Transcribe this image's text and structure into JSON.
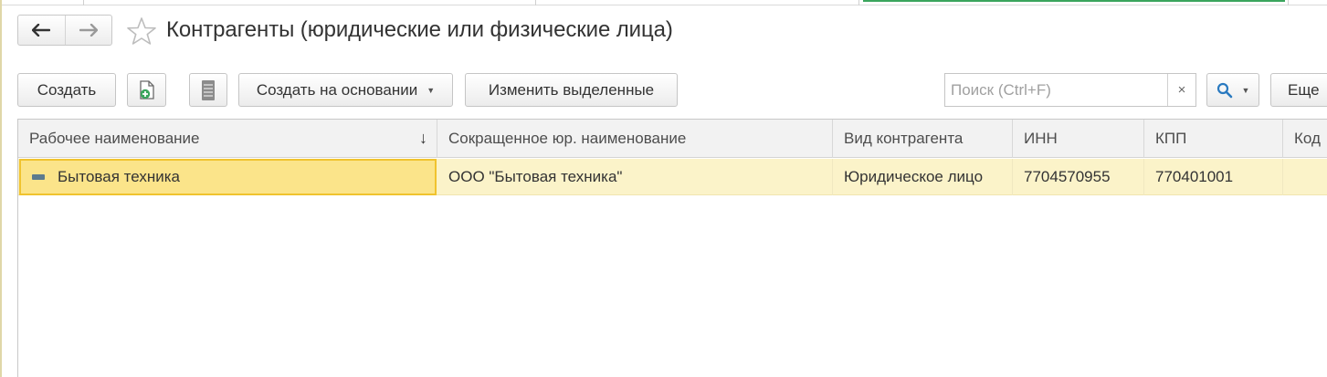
{
  "colors": {
    "accent_green": "#3aa55d",
    "selected_row": "#fbf3c9",
    "active_cell": "#fbe48a",
    "active_cell_border": "#f0c32e",
    "search_icon": "#2a7ac0"
  },
  "nav": {
    "back_icon": "arrow-left-icon",
    "forward_icon": "arrow-right-icon",
    "favorite_icon": "star-icon"
  },
  "window": {
    "title": "Контрагенты (юридические или физические лица)"
  },
  "toolbar": {
    "create_label": "Создать",
    "create_copy_icon": "add-document-icon",
    "list_icon": "list-settings-icon",
    "create_based_label": "Создать на основании",
    "edit_selected_label": "Изменить выделенные",
    "more_label": "Еще"
  },
  "search": {
    "placeholder": "Поиск (Ctrl+F)",
    "value": "",
    "clear_label": "×",
    "icon": "magnifier-icon"
  },
  "table": {
    "columns": [
      {
        "label": "Рабочее наименование",
        "sorted": "descending"
      },
      {
        "label": "Сокращенное юр. наименование"
      },
      {
        "label": "Вид контрагента"
      },
      {
        "label": "ИНН"
      },
      {
        "label": "КПП"
      },
      {
        "label": "Код"
      }
    ],
    "sort_indicator": "↓",
    "rows": [
      [
        "Бытовая техника",
        "ООО \"Бытовая техника\"",
        "Юридическое лицо",
        "7704570955",
        "770401001",
        ""
      ]
    ]
  }
}
